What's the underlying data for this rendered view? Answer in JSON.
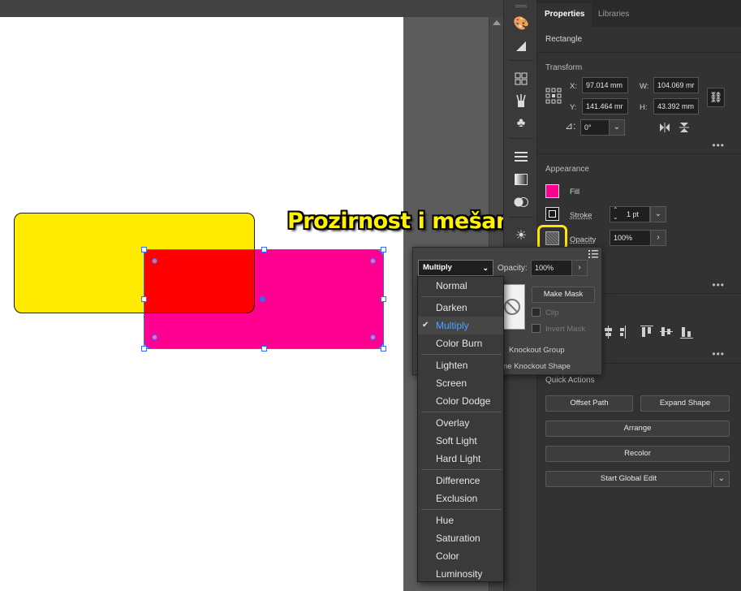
{
  "callout": "Prozirnost i mešanje",
  "tabs": [
    {
      "label": "Properties"
    },
    {
      "label": "Libraries"
    }
  ],
  "object_type": "Rectangle",
  "transform": {
    "title": "Transform",
    "x_label": "X:",
    "x_value": "97.014 mm",
    "y_label": "Y:",
    "y_value": "141.464 mr",
    "w_label": "W:",
    "w_value": "104.069 mr",
    "h_label": "H:",
    "h_value": "43.392 mm",
    "rotate_value": "0°"
  },
  "appearance": {
    "title": "Appearance",
    "fill_label": "Fill",
    "fill_color": "#ff0090",
    "stroke_label": "Stroke",
    "stroke_weight": "1 pt",
    "opacity_label": "Opacity",
    "opacity_value": "100%"
  },
  "quick_actions": {
    "title": "Quick Actions",
    "offset_path": "Offset Path",
    "expand_shape": "Expand Shape",
    "arrange": "Arrange",
    "recolor": "Recolor",
    "start_global_edit": "Start Global Edit"
  },
  "transparency": {
    "blend_mode": "Multiply",
    "opacity_label": "Opacity:",
    "opacity_value": "100%",
    "make_mask": "Make Mask",
    "clip": "Clip",
    "invert_mask": "Invert Mask",
    "knockout_group": "Knockout Group",
    "knockout_shape": "ne Knockout Shape"
  },
  "blend_modes": [
    {
      "label": "Normal"
    },
    {
      "label": "Darken"
    },
    {
      "label": "Multiply"
    },
    {
      "label": "Color Burn"
    },
    {
      "label": "Lighten"
    },
    {
      "label": "Screen"
    },
    {
      "label": "Color Dodge"
    },
    {
      "label": "Overlay"
    },
    {
      "label": "Soft Light"
    },
    {
      "label": "Hard Light"
    },
    {
      "label": "Difference"
    },
    {
      "label": "Exclusion"
    },
    {
      "label": "Hue"
    },
    {
      "label": "Saturation"
    },
    {
      "label": "Color"
    },
    {
      "label": "Luminosity"
    }
  ],
  "colors": {
    "yellow_shape": "#ffec00",
    "magenta_shape": "#ff0090",
    "overlap": "#ff0000",
    "selection": "#2f6fff",
    "highlight": "#ffe600"
  }
}
